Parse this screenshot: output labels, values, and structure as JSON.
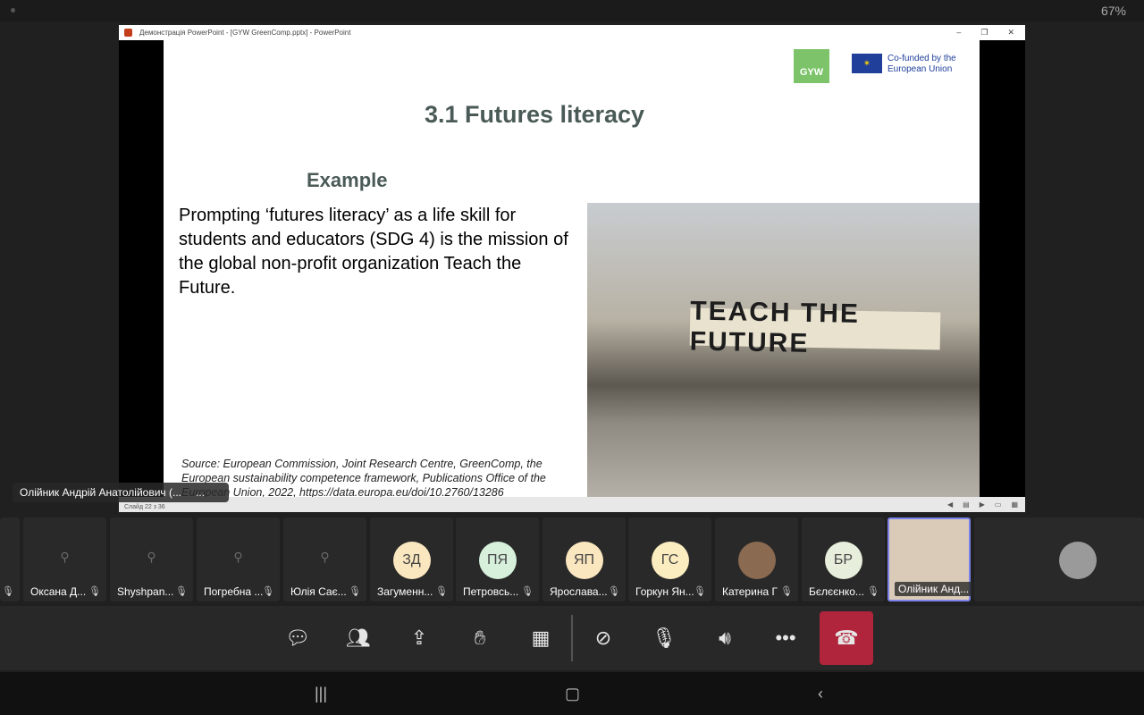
{
  "status": {
    "battery": "67%"
  },
  "window": {
    "title": "Демонстрація PowerPoint - [GYW  GreenComp.pptx] - PowerPoint",
    "controls": [
      "–",
      "❐",
      "✕"
    ],
    "slide_counter": "Слайд 22 з 36"
  },
  "slide": {
    "logo": "GYW",
    "eu_text": "Co-funded by the European Union",
    "title": "3.1 Futures literacy",
    "subtitle": "Example",
    "body": "Prompting ‘futures literacy’ as a life skill for students and educators (SDG 4) is the mission of the global non-profit organization Teach the Future.",
    "source": "Source: European Commission, Joint Research Centre, GreenComp, the European sustainability competence framework, Publications Office of the European Union, 2022, https://data.europa.eu/doi/10.2760/13286",
    "banner": "TEACH THE FUTURE"
  },
  "presenter": {
    "name": "Олійник Андрій Анатолійович (...",
    "more": "..."
  },
  "participants": [
    {
      "name": "",
      "initials": ""
    },
    {
      "name": "Оксана Д...",
      "initials": ""
    },
    {
      "name": "Shyshpan...",
      "initials": ""
    },
    {
      "name": "Погребна ...",
      "initials": ""
    },
    {
      "name": "Юлія Сає...",
      "initials": ""
    },
    {
      "name": "Загуменн...",
      "initials": "ЗД",
      "color": "#fbe7bf"
    },
    {
      "name": "Петровсь...",
      "initials": "ПЯ",
      "color": "#d6f0dc"
    },
    {
      "name": "Ярослава...",
      "initials": "ЯП",
      "color": "#fbe7bf"
    },
    {
      "name": "Горкун Ян...",
      "initials": "ГС",
      "color": "#fbedc0"
    },
    {
      "name": "Катерина Г",
      "initials": "",
      "color": "#8a6a50"
    },
    {
      "name": "Бєлєєнко...",
      "initials": "БР",
      "color": "#e7efdc"
    },
    {
      "name": "Олійник Анд...",
      "initials": ""
    }
  ],
  "controls": [
    "chat",
    "people",
    "share",
    "raise-hand",
    "view",
    "camera-off",
    "mic-off",
    "speaker",
    "more",
    "hang-up"
  ]
}
